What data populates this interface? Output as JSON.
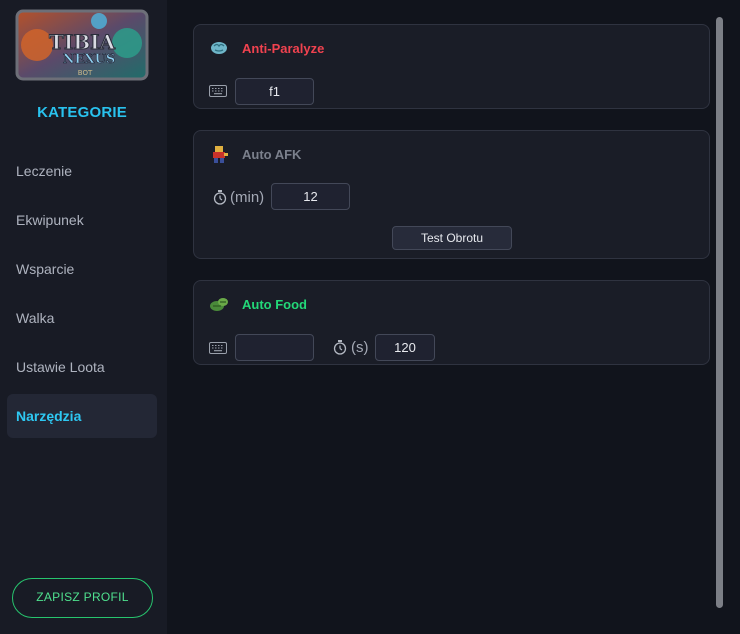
{
  "sidebar": {
    "category_title": "KATEGORIE",
    "items": [
      {
        "label": "Leczenie"
      },
      {
        "label": "Ekwipunek"
      },
      {
        "label": "Wsparcie"
      },
      {
        "label": "Walka"
      },
      {
        "label": "Ustawie Loota"
      },
      {
        "label": "Narzędzia",
        "active": true
      }
    ],
    "save_label": "ZAPISZ PROFIL"
  },
  "logo": {
    "line1": "TIBIA",
    "line2": "NEXUS",
    "line3": "BOT"
  },
  "cards": {
    "anti_paralyze": {
      "title": "Anti-Paralyze",
      "title_color": "#f0424f",
      "hotkey_value": "f1",
      "icon": "brain-icon"
    },
    "auto_afk": {
      "title": "Auto AFK",
      "title_color": "#7b808c",
      "interval_label": "(min)",
      "interval_value": "12",
      "test_button": "Test Obrotu",
      "icon": "runner-icon"
    },
    "auto_food": {
      "title": "Auto Food",
      "title_color": "#23d878",
      "hotkey_value": "",
      "interval_label": "(s)",
      "interval_value": "120",
      "icon": "food-icon"
    }
  },
  "colors": {
    "accent_blue": "#29c2ee",
    "accent_green": "#27c46e"
  }
}
